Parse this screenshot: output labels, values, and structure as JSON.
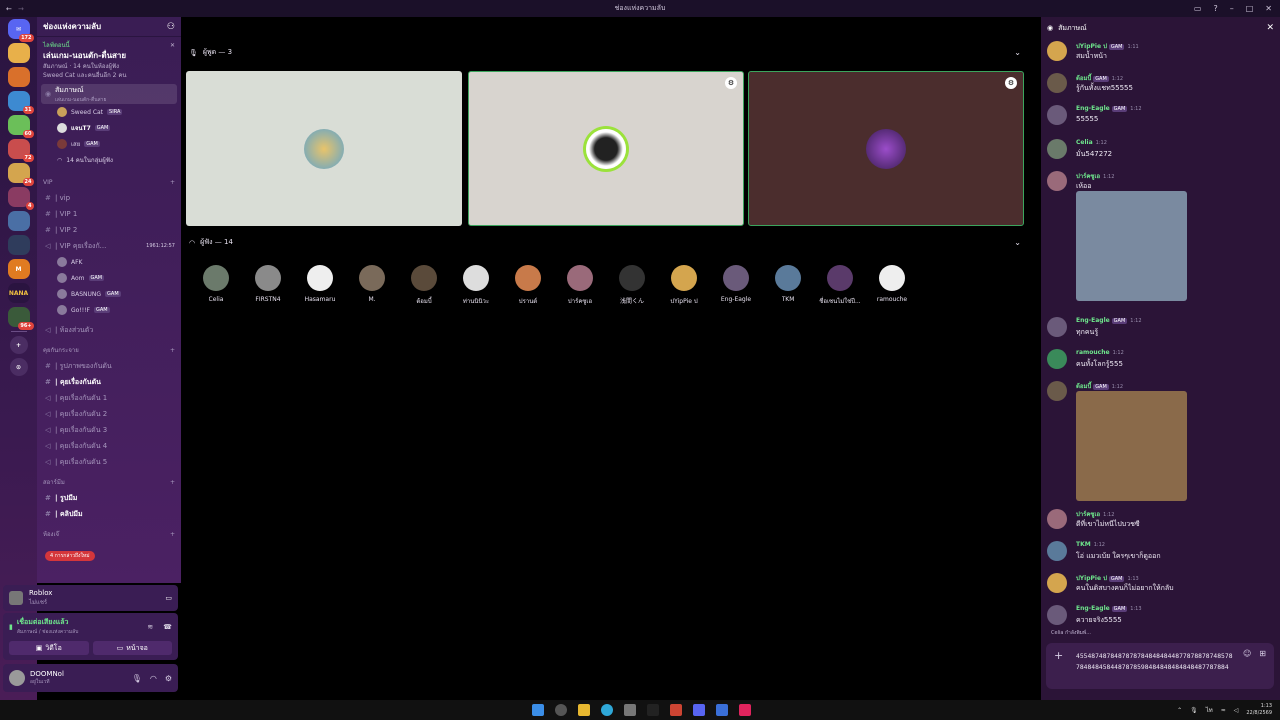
{
  "window": {
    "title": "ช่องแห่งความลับ"
  },
  "rail": {
    "badges": [
      "172",
      "31",
      "60",
      "72",
      "24",
      "4",
      "96+"
    ],
    "nana_label": "NANA"
  },
  "sidebar": {
    "server_name": "ช่องแห่งความลับ",
    "event_label": "ไลฟ์ตอนนี้",
    "event_title": "เล่นเกม-นอนตัก-ตื่นสาย",
    "event_sub1": "สัมภาษณ์ · 14 คนในห้องผู้ฟัง",
    "event_sub2": "Sweed Cat และคนอื่นอีก 2 คน",
    "active_channel": "สัมภาษณ์",
    "active_sub": "เล่นเกม-นอนตัก-ตื่นสาย",
    "voice_users": [
      {
        "name": "Sweed Cat",
        "tag": "SIRA"
      },
      {
        "name": "แจนT7",
        "tag": "GAM"
      },
      {
        "name": "เสย",
        "tag": "GAM"
      }
    ],
    "listeners_line": "14 คนในกลุ่มผู้ฟัง",
    "cat_vip": "VIP",
    "vip_channels": [
      "| vip",
      "| VIP 1",
      "| VIP 2"
    ],
    "vip_voice": "| VIP คุยเรื่องกั...",
    "vip_time": "1961:12:57",
    "vip_users": [
      {
        "name": "AFK",
        "tag": ""
      },
      {
        "name": "Aom",
        "tag": "GAM"
      },
      {
        "name": "BASNUNG",
        "tag": "GAM"
      },
      {
        "name": "Go!!!F",
        "tag": "GAM"
      }
    ],
    "private_room": "| ห้องส่วนตัว",
    "cat_talk": "คุยกันกระจาย",
    "talk_channels": [
      "| รูปภาพของกันดัน",
      "| คุยเรื่องกันดัน",
      "| คุยเรื่องกันดัน 1",
      "| คุยเรื่องกันดัน 2",
      "| คุยเรื่องกันดัน 3",
      "| คุยเรื่องกันดัน 4",
      "| คุยเรื่องกันดัน 5"
    ],
    "cat_meme": "สอาร์มีม",
    "meme_channels": [
      "| รูปมีม",
      "| คลิปมีม"
    ],
    "cat_rooms": "ห้องเจ๊",
    "new_mentions": "4 การกล่าวถึงใหม่"
  },
  "activity": {
    "game": "Roblox",
    "status": "ไม่แชร์"
  },
  "voice_panel": {
    "connected": "เชื่อมต่อเสียงแล้ว",
    "location": "สัมภาษณ์ / ช่องแห่งความลับ",
    "video_label": "วิดีโอ",
    "screen_label": "หน้าจอ"
  },
  "user_panel": {
    "name": "DOOMNol",
    "status": "อยู่ในเวที"
  },
  "stage": {
    "speakers_header": "ผู้พูด — 3",
    "audience_header": "ผู้ฟัง — 14",
    "audience": [
      "Celia",
      "FIRSTN4",
      "Hasamaru",
      "M.",
      "ต้อมบี้",
      "ท่านนินิวะ",
      "ปรานต์",
      "ปาร์คซูเอ",
      "浅間くん",
      "ปYipPie ป",
      "Eng-Eagle",
      "TKM",
      "ชื่อเซนไม่ใช่ปี...",
      "ramouche"
    ]
  },
  "chat": {
    "title": "สัมภาษณ์",
    "messages": [
      {
        "user": "ปYipPie ป",
        "tag": "GAM",
        "time": "1:11",
        "text": "สมน้ำหน้า"
      },
      {
        "user": "ต้อมบี้",
        "tag": "GAM",
        "time": "1:12",
        "text": "รู้กันทั้งแชท55555"
      },
      {
        "user": "Eng-Eagle",
        "tag": "GAM",
        "time": "1:12",
        "text": "55555"
      },
      {
        "user": "Celia",
        "tag": "",
        "time": "1:12",
        "text": "มั่น547272"
      },
      {
        "user": "ปาร์คซูเอ",
        "tag": "",
        "time": "1:12",
        "text": "เห้ออ"
      },
      {
        "user": "Eng-Eagle",
        "tag": "GAM",
        "time": "1:12",
        "text": "ทุกคนรู้"
      },
      {
        "user": "ramouche",
        "tag": "",
        "time": "1:12",
        "text": "คนทั้งโลกรู้555"
      },
      {
        "user": "ต้อมบี้",
        "tag": "GAM",
        "time": "1:12",
        "text": ""
      },
      {
        "user": "ปาร์คซูเอ",
        "tag": "",
        "time": "1:12",
        "text": "ดีที่เขาไม่หนีไปบวชซี"
      },
      {
        "user": "TKM",
        "tag": "",
        "time": "1:12",
        "text": "โอ่ แมวเบ้ย ใครๆเขาก็ดูออก"
      },
      {
        "user": "ปYipPie ป",
        "tag": "GAM",
        "time": "1:13",
        "text": "คนในดิสบางคนก็ไม่อยากให้กลับ"
      },
      {
        "user": "Eng-Eagle",
        "tag": "GAM",
        "time": "1:13",
        "text": "ควายจริง5555"
      }
    ],
    "typing": "Celia กำลังพิมพ์...",
    "composer_value": "455487487848787878484848448778788787485787848484584487878598484848484848487787884"
  },
  "taskbar": {
    "time": "1:13",
    "date": "22/8/2569"
  },
  "colors": {
    "accent_green": "#6ee68c",
    "sidebar": "#3a1d54",
    "chat_bg": "#2b1437"
  }
}
